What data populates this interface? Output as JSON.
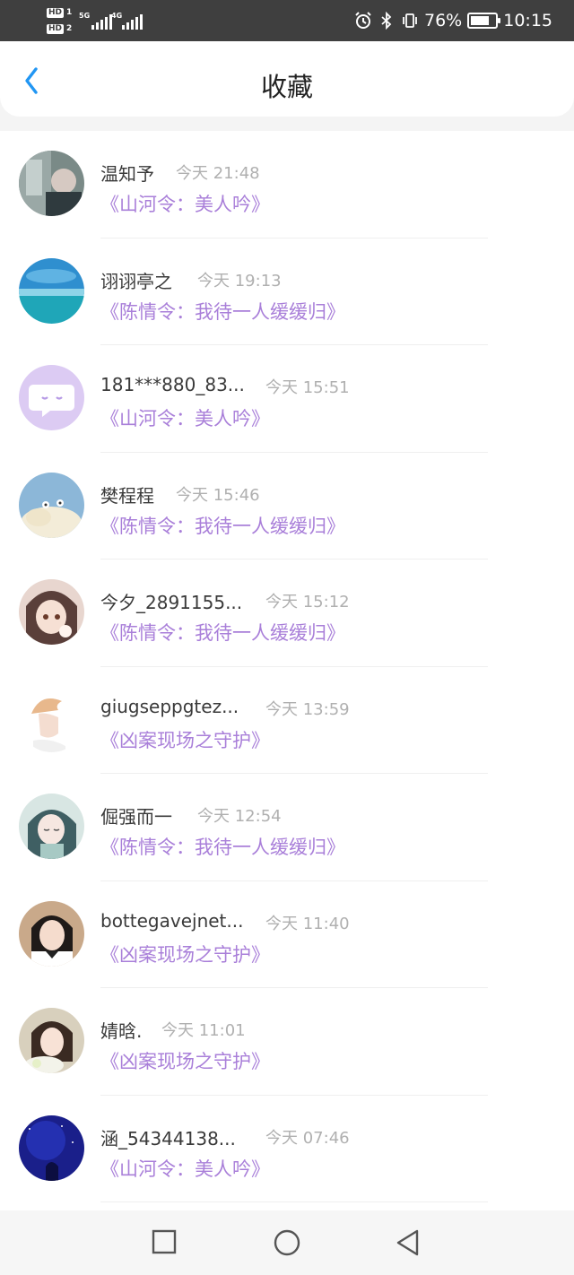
{
  "status_bar": {
    "sim1": "HD",
    "sim1_num": "1",
    "sim2": "HD",
    "sim2_num": "2",
    "net1": "5G",
    "net2": "4G",
    "battery_percent": "76%",
    "battery_level": 0.76,
    "time": "10:15",
    "icons": [
      "alarm-icon",
      "bluetooth-icon",
      "vibrate-icon",
      "battery-icon"
    ]
  },
  "header": {
    "title": "收藏",
    "back_icon": "chevron-left-icon",
    "accent_color": "#2196f3"
  },
  "colors": {
    "work_title": "#a97fd9",
    "name": "#3a3a3a",
    "time": "#b0b0b0"
  },
  "items": [
    {
      "name": "温知予",
      "time": "今天 21:48",
      "work": "《山河令：美人吟》",
      "avatar": "photo-avatar"
    },
    {
      "name": "诩诩亭之",
      "time": "今天 19:13",
      "work": "《陈情令：我待一人缓缓归》",
      "avatar": "sea-avatar"
    },
    {
      "name": "181***880_83...",
      "time": "今天 15:51",
      "work": "《山河令：美人吟》",
      "avatar": "default-chat-avatar"
    },
    {
      "name": "樊程程",
      "time": "今天 15:46",
      "work": "《陈情令：我待一人缓缓归》",
      "avatar": "cloud-avatar"
    },
    {
      "name": "今夕_2891155...",
      "time": "今天 15:12",
      "work": "《陈情令：我待一人缓缓归》",
      "avatar": "anime-girl-avatar"
    },
    {
      "name": "giugseppgtez...",
      "time": "今天 13:59",
      "work": "《凶案现场之守护》",
      "avatar": "illustration-avatar"
    },
    {
      "name": "倔强而一",
      "time": "今天 12:54",
      "work": "《陈情令：我待一人缓缓归》",
      "avatar": "anime-avatar"
    },
    {
      "name": "bottegavejnet...",
      "time": "今天 11:40",
      "work": "《凶案现场之守护》",
      "avatar": "portrait-avatar"
    },
    {
      "name": "婧晗.",
      "time": "今天 11:01",
      "work": "《凶案现场之守护》",
      "avatar": "girl-portrait-avatar"
    },
    {
      "name": "涵_54344138...",
      "time": "今天 07:46",
      "work": "《山河令：美人吟》",
      "avatar": "night-sky-avatar"
    }
  ],
  "nav_bar": {
    "recents_icon": "square-icon",
    "home_icon": "circle-icon",
    "back_icon": "triangle-back-icon"
  }
}
